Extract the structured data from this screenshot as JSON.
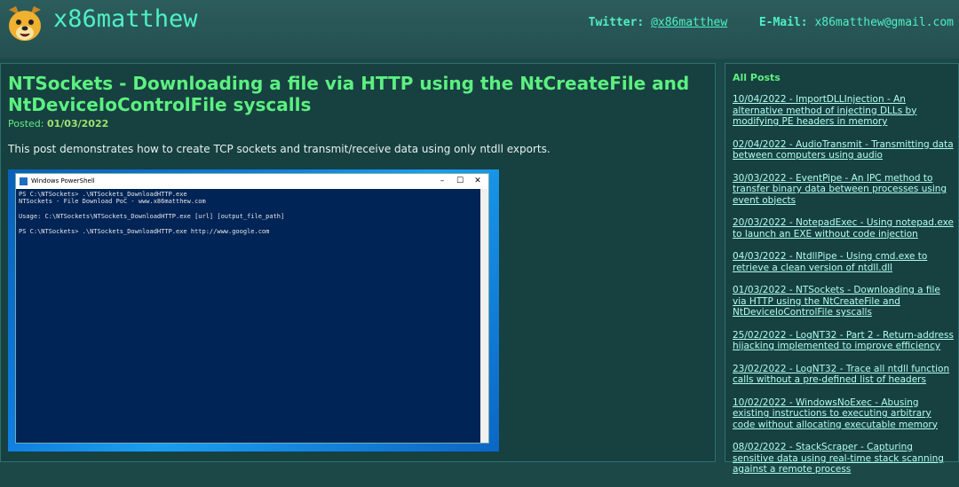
{
  "header": {
    "site_title": "x86matthew",
    "twitter_label": "Twitter:",
    "twitter_handle": "@x86matthew",
    "email_label": "E-Mail:",
    "email": "x86matthew@gmail.com"
  },
  "post": {
    "title": "NTSockets - Downloading a file via HTTP using the NtCreateFile and NtDeviceIoControlFile syscalls",
    "posted_label": "Posted:",
    "posted_date": "01/03/2022",
    "intro": "This post demonstrates how to create TCP sockets and transmit/receive data using only ntdll exports.",
    "screenshot": {
      "window_title": "Windows PowerShell",
      "lines": [
        "PS C:\\NTSockets> .\\NTSockets_DownloadHTTP.exe",
        "NTSockets - File Download PoC - www.x86matthew.com",
        "",
        "Usage: C:\\NTSockets\\NTSockets_DownloadHTTP.exe [url] [output_file_path]",
        "",
        "PS C:\\NTSockets> .\\NTSockets_DownloadHTTP.exe http://www.google.com"
      ]
    }
  },
  "sidebar": {
    "heading": "All Posts",
    "items": [
      "10/04/2022 - ImportDLLInjection - An alternative method of injecting DLLs by modifying PE headers in memory",
      "02/04/2022 - AudioTransmit - Transmitting data between computers using audio",
      "30/03/2022 - EventPipe - An IPC method to transfer binary data between processes using event objects",
      "20/03/2022 - NotepadExec - Using notepad.exe to launch an EXE without code injection",
      "04/03/2022 - NtdllPipe - Using cmd.exe to retrieve a clean version of ntdll.dll",
      "01/03/2022 - NTSockets - Downloading a file via HTTP using the NtCreateFile and NtDeviceIoControlFile syscalls",
      "25/02/2022 - LogNT32 - Part 2 - Return-address hijacking implemented to improve efficiency",
      "23/02/2022 - LogNT32 - Trace all ntdll function calls without a pre-defined list of headers",
      "10/02/2022 - WindowsNoExec - Abusing existing instructions to executing arbitrary code without allocating executable memory",
      "08/02/2022 - StackScraper - Capturing sensitive data using real-time stack scanning against a remote process"
    ]
  },
  "colors": {
    "accent": "#4ef0c4",
    "title_green": "#5cf080",
    "link": "#b0ffee",
    "background": "#1c4848"
  }
}
